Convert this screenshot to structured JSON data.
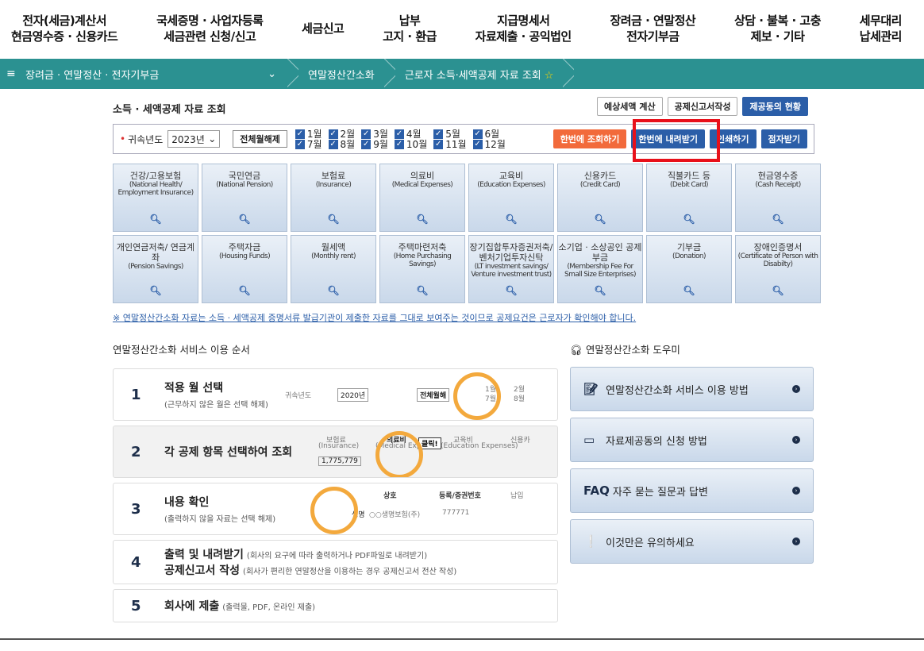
{
  "topnav": [
    {
      "l1": "전자(세금)계산서",
      "l2": "현금영수증 · 신용카드"
    },
    {
      "l1": "국세증명 · 사업자등록",
      "l2": "세금관련 신청/신고"
    },
    {
      "l1": "세금신고",
      "l2": ""
    },
    {
      "l1": "납부",
      "l2": "고지 · 환급"
    },
    {
      "l1": "지급명세서",
      "l2": "자료제출 · 공익법인"
    },
    {
      "l1": "장려금 · 연말정산",
      "l2": "전자기부금"
    },
    {
      "l1": "상담 · 불복 · 고충",
      "l2": "제보 · 기타"
    },
    {
      "l1": "세무대리",
      "l2": "납세관리"
    }
  ],
  "breadcrumb": {
    "menu_icon": "≡",
    "c1": "장려금 · 연말정산 · 전자기부금",
    "c2": "연말정산간소화",
    "c3": "근로자 소득·세액공제 자료 조회",
    "star": "☆"
  },
  "page": {
    "title": "소득 · 세액공제 자료 조회",
    "btn_estimate": "예상세액 계산",
    "btn_write": "공제신고서작성",
    "btn_status": "제공동의 현황"
  },
  "filter": {
    "year_label": "귀속년도",
    "year_value": "2023년",
    "all_clear": "전체월해제",
    "months": [
      "1월",
      "2월",
      "3월",
      "4월",
      "5월",
      "6월",
      "7월",
      "8월",
      "9월",
      "10월",
      "11월",
      "12월"
    ],
    "btn_query_all": "한번에 조회하기",
    "btn_download_all": "한번에 내려받기",
    "btn_print": "인쇄하기",
    "btn_braille": "점자받기"
  },
  "categories": [
    {
      "k": "건강/고용보험",
      "e": "(National Health/ Employment Insurance)"
    },
    {
      "k": "국민연금",
      "e": "(National Pension)"
    },
    {
      "k": "보험료",
      "e": "(Insurance)"
    },
    {
      "k": "의료비",
      "e": "(Medical Expenses)"
    },
    {
      "k": "교육비",
      "e": "(Education Expenses)"
    },
    {
      "k": "신용카드",
      "e": "(Credit Card)"
    },
    {
      "k": "직불카드 등",
      "e": "(Debit Card)"
    },
    {
      "k": "현금영수증",
      "e": "(Cash Receipt)"
    },
    {
      "k": "개인연금저축/ 연금계좌",
      "e": "(Pension Savings)"
    },
    {
      "k": "주택자금",
      "e": "(Housing Funds)"
    },
    {
      "k": "월세액",
      "e": "(Monthly rent)"
    },
    {
      "k": "주택마련저축",
      "e": "(Home Purchasing Savings)"
    },
    {
      "k": "장기집합투자증권저축/ 벤처기업투자신탁",
      "e": "(LT investment savings/ Venture investment trust)"
    },
    {
      "k": "소기업 · 소상공인 공제부금",
      "e": "(Membership Fee For Small Size Enterprises)"
    },
    {
      "k": "기부금",
      "e": "(Donation)"
    },
    {
      "k": "장애인증명서",
      "e": "(Certificate of Person with Disabilty)"
    }
  ],
  "notice": "※ 연말정산간소화 자료는 소득 · 세액공제 증명서류 발급기관이 제출한 자료를 그대로 보여주는 것이므로 공제요건은 근로자가 확인해야 합니다.",
  "steps_title": "연말정산간소화 서비스 이용 순서",
  "steps": [
    {
      "n": "1",
      "t": "적용 월 선택",
      "sub": "(근무하지 않은 월은 선택 해제)"
    },
    {
      "n": "2",
      "t": "각 공제 항목 선택하여 조회",
      "sub": ""
    },
    {
      "n": "3",
      "t": "내용 확인",
      "sub": "(출력하지 않을 자료는 선택 해제)"
    },
    {
      "n": "4",
      "t": "출력 및 내려받기",
      "s": "(회사의 요구에 따라 출력하거나 PDF파일로 내려받기)",
      "t2": "공제신고서 작성",
      "s2": "(회사가 편리한 연말정산을 이용하는 경우 공제신고서 전산 작성)"
    },
    {
      "n": "5",
      "t": "회사에 제출",
      "s": "(출력물, PDF, 온라인 제출)"
    }
  ],
  "demo": {
    "year_label": "귀속년도",
    "year": "2020년",
    "all": "전체월해",
    "m1": "1월",
    "m7": "7월",
    "m2": "2월",
    "m8": "8월",
    "ins": "보험료",
    "ins_e": "(Insurance)",
    "ins_val": "1,775,779",
    "med": "의료비",
    "med_e": "(Medical Expen",
    "click": "클릭!",
    "edu": "교육비",
    "edu_e": "(Education Expenses)",
    "cred": "신용카",
    "col1": "상호",
    "col2": "등록/증권번호",
    "col3": "납입",
    "row1": "○○생명보험(주)",
    "row1v": "777771",
    "name_lbl": "생명"
  },
  "helper_title": "연말정산간소화 도우미",
  "helper": [
    {
      "icon": "document-pen-icon",
      "label": "연말정산간소화 서비스 이용 방법"
    },
    {
      "icon": "document-icon",
      "label": "자료제공동의 신청 방법"
    },
    {
      "icon": "faq-icon",
      "label": "자주 묻는 질문과 답변",
      "prefix": "FAQ"
    },
    {
      "icon": "exclamation-icon",
      "label": "이것만은 유의하세요"
    }
  ]
}
